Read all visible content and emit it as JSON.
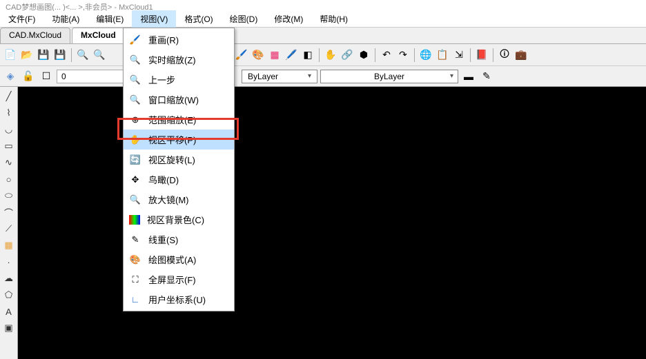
{
  "title": "CAD梦想画图(... )<... >,非会员> - MxCloud1",
  "menu": {
    "file": "文件(F)",
    "func": "功能(A)",
    "edit": "编辑(E)",
    "view": "视图(V)",
    "format": "格式(O)",
    "draw": "绘图(D)",
    "modify": "修改(M)",
    "help": "帮助(H)"
  },
  "tabs": {
    "tab1": "CAD.MxCloud",
    "tab2": "MxCloud"
  },
  "toolbar2": {
    "layer_value": "0",
    "combo1": "ByLayer",
    "combo2": "ByLayer"
  },
  "dropdown": {
    "redraw": "重画(R)",
    "realtime_zoom": "实时缩放(Z)",
    "prev_step": "上一步",
    "window_zoom": "窗口缩放(W)",
    "extent_zoom": "范围缩放(E)",
    "pan_view": "视区平移(P)",
    "rotate_view": "视区旋转(L)",
    "bird_eye": "鸟瞰(D)",
    "magnifier": "放大镜(M)",
    "bg_color": "视区背景色(C)",
    "regen": "线重(S)",
    "draw_mode": "绘图模式(A)",
    "fullscreen": "全屏显示(F)",
    "ucs": "用户坐标系(U)"
  }
}
